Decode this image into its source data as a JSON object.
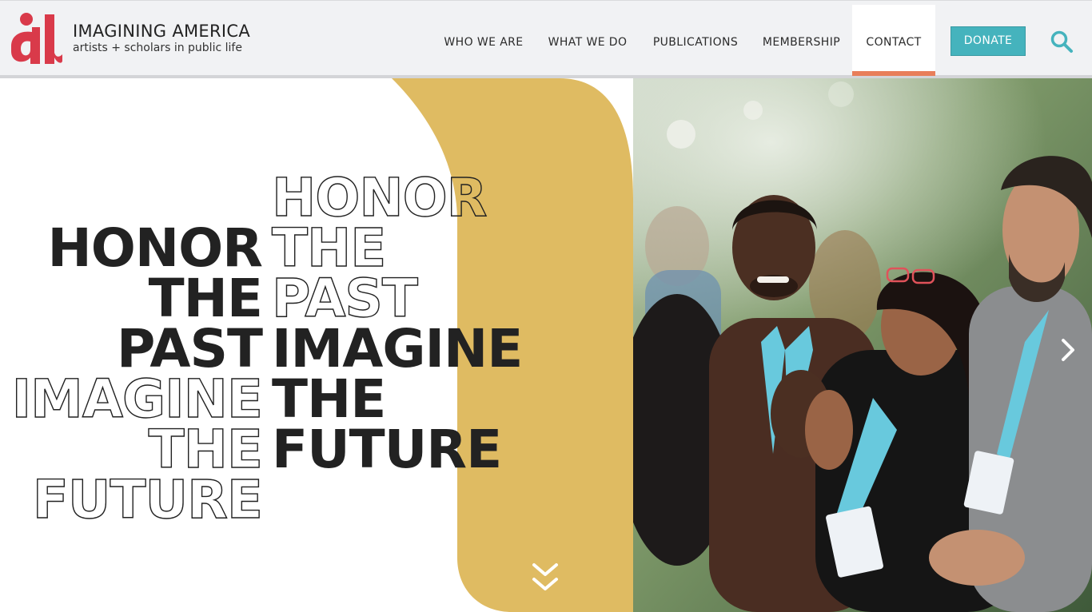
{
  "brand": {
    "name": "IMAGINING AMERICA",
    "tagline": "artists + scholars in public life",
    "logo_icon": "ia-logo-icon",
    "logo_color": "#d93a4a"
  },
  "nav": {
    "items": [
      {
        "label": "WHO WE ARE"
      },
      {
        "label": "WHAT WE DO"
      },
      {
        "label": "PUBLICATIONS"
      },
      {
        "label": "MEMBERSHIP"
      },
      {
        "label": "CONTACT",
        "active": true
      }
    ],
    "donate_label": "DONATE",
    "donate_color": "#45b3bd",
    "active_underline_color": "#e87e5a",
    "search_icon": "search-icon"
  },
  "hero": {
    "left_lines": [
      "HONOR",
      "THE",
      "PAST",
      "IMAGINE",
      "THE",
      "FUTURE"
    ],
    "left_styles": [
      "solid",
      "solid",
      "solid",
      "outline",
      "outline",
      "outline"
    ],
    "right_lines": [
      "HONOR",
      "THE",
      "PAST",
      "IMAGINE",
      "THE",
      "FUTURE"
    ],
    "right_styles": [
      "outline",
      "outline",
      "outline",
      "solid",
      "solid",
      "solid"
    ],
    "accent_color": "#dfbb62",
    "next_icon": "chevron-right-icon",
    "scroll_icon": "double-chevron-down-icon"
  }
}
